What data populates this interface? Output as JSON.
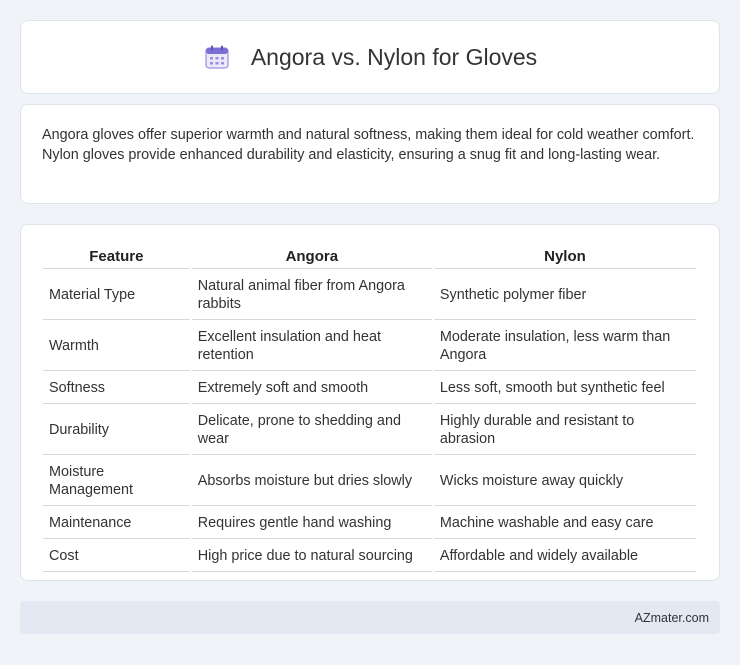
{
  "header": {
    "title": "Angora vs. Nylon for Gloves",
    "icon": "calendar-icon"
  },
  "intro": {
    "text": "Angora gloves offer superior warmth and natural softness, making them ideal for cold weather comfort. Nylon gloves provide enhanced durability and elasticity, ensuring a snug fit and long-lasting wear."
  },
  "table": {
    "headers": [
      "Feature",
      "Angora",
      "Nylon"
    ],
    "rows": [
      [
        "Material Type",
        "Natural animal fiber from Angora rabbits",
        "Synthetic polymer fiber"
      ],
      [
        "Warmth",
        "Excellent insulation and heat retention",
        "Moderate insulation, less warm than Angora"
      ],
      [
        "Softness",
        "Extremely soft and smooth",
        "Less soft, smooth but synthetic feel"
      ],
      [
        "Durability",
        "Delicate, prone to shedding and wear",
        "Highly durable and resistant to abrasion"
      ],
      [
        "Moisture Management",
        "Absorbs moisture but dries slowly",
        "Wicks moisture away quickly"
      ],
      [
        "Maintenance",
        "Requires gentle hand washing",
        "Machine washable and easy care"
      ],
      [
        "Cost",
        "High price due to natural sourcing",
        "Affordable and widely available"
      ]
    ]
  },
  "footer": {
    "brand": "AZmater.com"
  },
  "colors": {
    "background": "#f0f3f8",
    "card": "#ffffff",
    "footer": "#e3e9f3",
    "icon_accent": "#7b6fd6"
  }
}
